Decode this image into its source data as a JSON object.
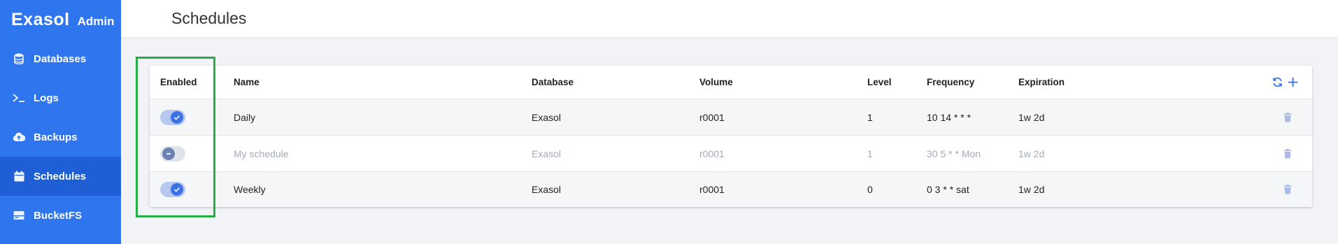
{
  "app": {
    "logo": "Exasol",
    "subtitle": "Admin"
  },
  "sidebar": {
    "items": [
      {
        "label": "Databases",
        "icon": "database-icon",
        "active": false
      },
      {
        "label": "Logs",
        "icon": "terminal-icon",
        "active": false
      },
      {
        "label": "Backups",
        "icon": "cloud-upload-icon",
        "active": false
      },
      {
        "label": "Schedules",
        "icon": "calendar-icon",
        "active": true
      },
      {
        "label": "BucketFS",
        "icon": "storage-icon",
        "active": false
      }
    ]
  },
  "header": {
    "title": "Schedules"
  },
  "table": {
    "columns": [
      "Enabled",
      "Name",
      "Database",
      "Volume",
      "Level",
      "Frequency",
      "Expiration"
    ],
    "actions": {
      "refresh": "refresh-icon",
      "add": "plus-icon"
    },
    "rows": [
      {
        "enabled": true,
        "name": "Daily",
        "database": "Exasol",
        "volume": "r0001",
        "level": "1",
        "frequency": "10 14 * * *",
        "expiration": "1w 2d"
      },
      {
        "enabled": false,
        "name": "My schedule",
        "database": "Exasol",
        "volume": "r0001",
        "level": "1",
        "frequency": "30 5 * * Mon",
        "expiration": "1w 2d"
      },
      {
        "enabled": true,
        "name": "Weekly",
        "database": "Exasol",
        "volume": "r0001",
        "level": "0",
        "frequency": "0 3 * * sat",
        "expiration": "1w 2d"
      }
    ]
  },
  "colors": {
    "sidebar": "#2e75ee",
    "sidebar_active": "#1f5fd6",
    "accent": "#3b73e6",
    "highlight": "#27ae45"
  }
}
